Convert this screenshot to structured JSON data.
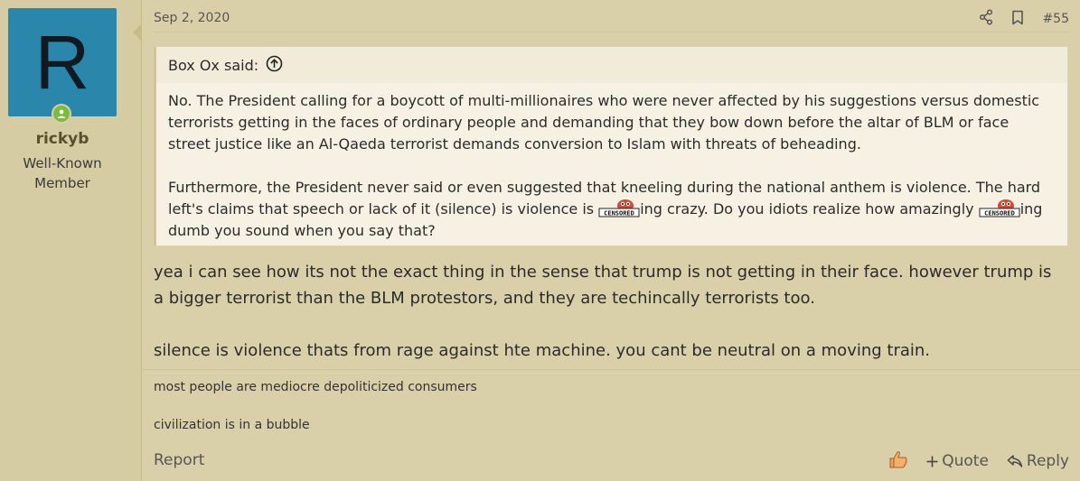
{
  "user": {
    "avatar_letter": "R",
    "username": "rickyb",
    "title": "Well-Known Member",
    "avatar_color": "#2a87ab"
  },
  "post": {
    "date": "Sep 2, 2020",
    "number": "#55",
    "share_icon": "share-icon",
    "bookmark_icon": "bookmark-icon"
  },
  "quote": {
    "author_label": "Box Ox said:",
    "paragraph1": "No. The President calling for a boycott of multi-millionaires who were never affected by his suggestions versus domestic terrorists getting in the faces of ordinary people and demanding that they bow down before the altar of BLM or face street justice like an Al-Qaeda terrorist demands conversion to Islam with threats of beheading.",
    "paragraph2_a": "Furthermore, the President never said or even suggested that kneeling during the national anthem is violence. The hard left's claims that speech or lack of it (silence) is violence is ",
    "paragraph2_b": "ing crazy. Do you idiots realize how amazingly ",
    "paragraph2_c": "ing dumb you sound when you say that?",
    "censored_label": "CENSORED"
  },
  "body": {
    "paragraph1": "yea i can see how its not the exact thing in the sense that trump is not getting in their face. however trump is a bigger terrorist than the BLM protestors, and they are techincally terrorists too.",
    "paragraph2": "silence is violence thats from rage against hte machine. you cant be neutral on a moving train."
  },
  "signature": {
    "line1": "most people are mediocre depoliticized consumers",
    "line2": "civilization is in a bubble"
  },
  "footer": {
    "report": "Report",
    "quote": "Quote",
    "reply": "Reply"
  }
}
